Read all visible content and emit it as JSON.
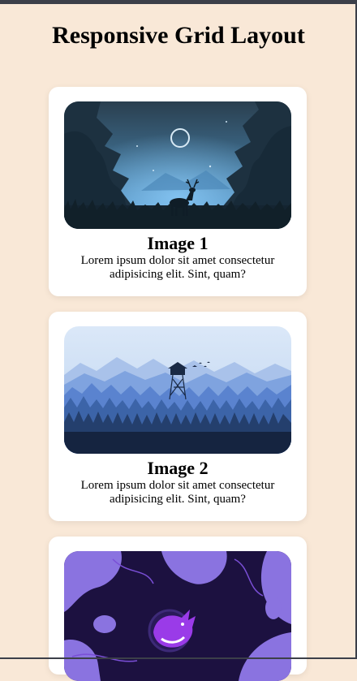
{
  "page": {
    "title": "Responsive Grid Layout"
  },
  "cards": [
    {
      "title": "Image 1",
      "description": "Lorem ipsum dolor sit amet consectetur adipisicing elit. Sint, quam?",
      "image": "night-forest-deer-illustration"
    },
    {
      "title": "Image 2",
      "description": "Lorem ipsum dolor sit amet consectetur adipisicing elit. Sint, quam?",
      "image": "blue-mountains-watchtower-illustration"
    },
    {
      "title": "",
      "description": "",
      "image": "purple-rhino-logo-illustration"
    }
  ],
  "colors": {
    "background": "#f9e8d7",
    "card": "#ffffff",
    "frame": "#3c3f49"
  }
}
